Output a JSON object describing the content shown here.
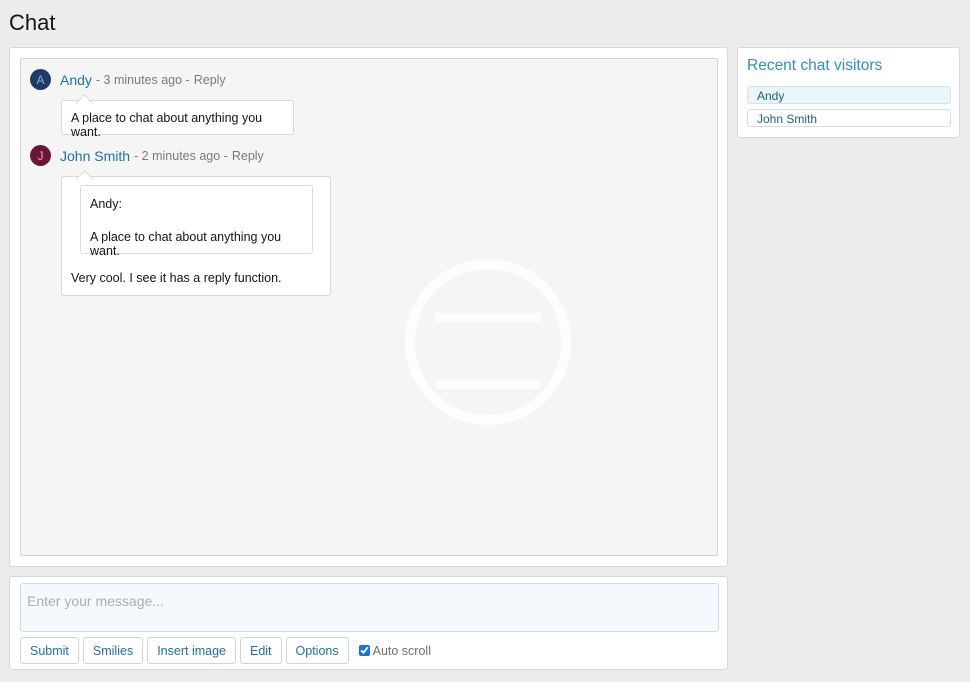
{
  "page": {
    "title": "Chat"
  },
  "messages": [
    {
      "author": "Andy",
      "avatar_letter": "A",
      "time": "- 3 minutes ago -",
      "reply_label": "Reply",
      "text": "A place to chat about anything you want."
    },
    {
      "author": "John Smith",
      "avatar_letter": "J",
      "time": "- 2 minutes ago -",
      "reply_label": "Reply",
      "quote": {
        "author_line": "Andy:",
        "text": "A place to chat about anything you want."
      },
      "text": "Very cool. I see it has a reply function."
    }
  ],
  "composer": {
    "placeholder": "Enter your message...",
    "buttons": {
      "submit": "Submit",
      "smilies": "Smilies",
      "insert_image": "Insert image",
      "edit": "Edit",
      "options": "Options"
    },
    "auto_scroll_label": "Auto scroll",
    "auto_scroll_checked": true
  },
  "visitors": {
    "title": "Recent chat visitors",
    "items": [
      {
        "name": "Andy"
      },
      {
        "name": "John Smith"
      }
    ]
  },
  "icons": {
    "avatar": "user-initial-avatar",
    "checkbox": "checkbox-checked-icon",
    "watermark": "watermark-logo"
  },
  "colors": {
    "link": "#1f6fa6",
    "title_accent": "#2e8fca",
    "page_bg": "#ececec",
    "log_bg": "#f5f5f5"
  }
}
